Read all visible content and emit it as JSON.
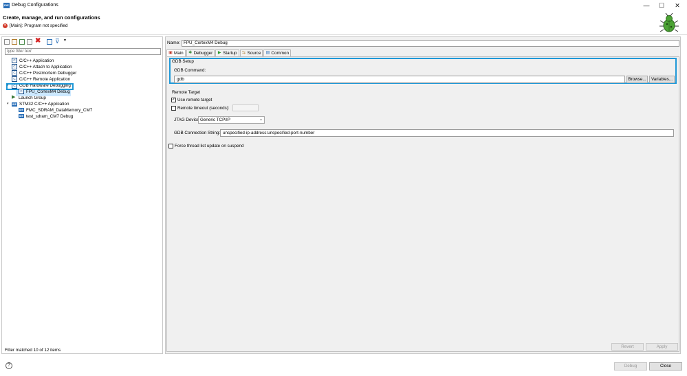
{
  "window": {
    "title": "Debug Configurations",
    "app_icon": "IDE",
    "controls": [
      "—",
      "☐",
      "✕"
    ]
  },
  "header": {
    "title": "Create, manage, and run configurations",
    "error_message": "[Main]: Program not specified"
  },
  "left": {
    "filter_placeholder": "type filter text",
    "tree": [
      {
        "label": "C/C++ Application",
        "icon": "c-config-icon",
        "indent": 1
      },
      {
        "label": "C/C++ Attach to Application",
        "icon": "c-config-icon",
        "indent": 1
      },
      {
        "label": "C/C++ Postmortem Debugger",
        "icon": "c-config-icon",
        "indent": 1
      },
      {
        "label": "C/C++ Remote Application",
        "icon": "c-config-icon",
        "indent": 1
      },
      {
        "label": "GDB Hardware Debugging",
        "icon": "c-config-icon",
        "indent": 1
      },
      {
        "label": "FPU_CortexM4 Debug",
        "icon": "c-config-icon",
        "indent": 2
      },
      {
        "label": "Launch Group",
        "icon": "launch-group-icon",
        "indent": 1
      },
      {
        "label": "STM32 C/C++ Application",
        "icon": "ide-icon",
        "indent": 1
      },
      {
        "label": "FMC_SDRAM_DataMemory_CM7",
        "icon": "ide-icon",
        "indent": 2
      },
      {
        "label": "test_sdram_CM7 Debug",
        "icon": "ide-icon",
        "indent": 2
      }
    ],
    "filter_status": "Filter matched 10 of 12 items"
  },
  "right": {
    "name_label": "Name:",
    "name_value": "FPU_CortexM4 Debug",
    "tabs": [
      {
        "label": "Main",
        "icon": "main-tab-icon"
      },
      {
        "label": "Debugger",
        "icon": "debugger-tab-icon"
      },
      {
        "label": "Startup",
        "icon": "startup-tab-icon"
      },
      {
        "label": "Source",
        "icon": "source-tab-icon"
      },
      {
        "label": "Common",
        "icon": "common-tab-icon"
      }
    ],
    "gdb_setup_label": "GDB Setup",
    "gdb_command_label": "GDB Command:",
    "gdb_command_value": "gdb",
    "browse_label": "Browse...",
    "variables_label": "Variables...",
    "remote_target_label": "Remote Target",
    "use_remote_label": "Use remote target",
    "use_remote_checked": "✓",
    "remote_timeout_label": "Remote timeout (seconds):",
    "jtag_label": "JTAG Device:",
    "jtag_value": "Generic TCP/IP",
    "conn_label": "GDB Connection String:",
    "conn_value": "unspecified-ip-address:unspecified-port-number",
    "force_thread_label": "Force thread list update on suspend",
    "revert_label": "Revert",
    "apply_label": "Apply"
  },
  "footer": {
    "help": "?",
    "debug_label": "Debug",
    "close_label": "Close"
  }
}
